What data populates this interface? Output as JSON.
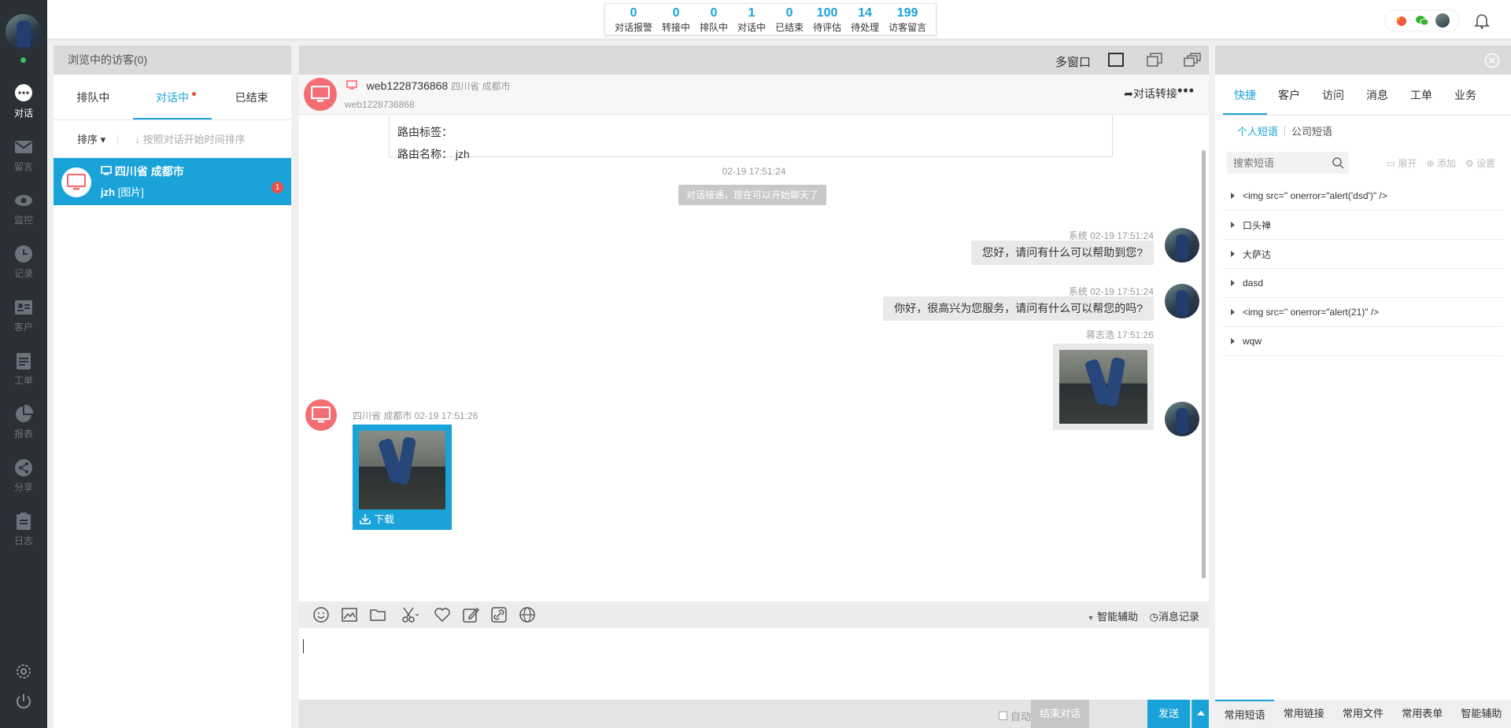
{
  "nav": {
    "items": [
      {
        "label": "对话",
        "icon": "chat-icon"
      },
      {
        "label": "留言",
        "icon": "mail-icon"
      },
      {
        "label": "监控",
        "icon": "eye-icon"
      },
      {
        "label": "记录",
        "icon": "clock-icon"
      },
      {
        "label": "客户",
        "icon": "id-card-icon"
      },
      {
        "label": "工单",
        "icon": "ticket-icon"
      },
      {
        "label": "报表",
        "icon": "pie-chart-icon"
      },
      {
        "label": "分享",
        "icon": "share-icon"
      },
      {
        "label": "日志",
        "icon": "clipboard-icon"
      }
    ]
  },
  "stats": [
    {
      "num": "0",
      "label": "对话报警"
    },
    {
      "num": "0",
      "label": "转接中"
    },
    {
      "num": "0",
      "label": "排队中"
    },
    {
      "num": "1",
      "label": "对话中"
    },
    {
      "num": "0",
      "label": "已结束"
    },
    {
      "num": "100",
      "label": "待评估"
    },
    {
      "num": "14",
      "label": "待处理"
    },
    {
      "num": "199",
      "label": "访客留言"
    }
  ],
  "visitors": {
    "title": "浏览中的访客(0)",
    "tabs": [
      "排队中",
      "对话中",
      "已结束"
    ],
    "sort_label": "排序",
    "sort_hint": "按照对话开始时间排序",
    "conversation": {
      "location": "四川省 成都市",
      "name": "jzh",
      "last_msg": "[图片]",
      "unread": "1"
    }
  },
  "chat": {
    "multi_window": "多窗口",
    "visitor_name": "web1228736868",
    "visitor_location": "四川省 成都市",
    "visitor_sub": "web1228736868",
    "transfer": "对话转接",
    "route_tag": "路由标签：",
    "route_name": "路由名称：  jzh",
    "time1": "02-19 17:51:24",
    "sys_note": "对话接通，现在可以开始聊天了",
    "msg1_meta": "系统  02-19 17:51:24",
    "msg1": "您好，请问有什么可以帮助到您?",
    "msg2_meta": "系统  02-19 17:51:24",
    "msg2": "你好，很高兴为您服务，请问有什么可以帮您的吗?",
    "msg3_meta": "蒋志浩  17:51:26",
    "msg4_meta": "四川省 成都市  02-19 17:51:26",
    "download": "下载",
    "assist": "智能辅助",
    "history": "消息记录",
    "auto_switch": "自动切换对话",
    "end_btn": "结束对话",
    "send_btn": "发送"
  },
  "right": {
    "tabs": [
      "快捷",
      "客户",
      "访问",
      "消息",
      "工单",
      "业务"
    ],
    "subtabs": [
      "个人短语",
      "公司短语"
    ],
    "search_placeholder": "搜索短语",
    "tool_expand": "展开",
    "tool_add": "添加",
    "tool_settings": "设置",
    "phrases": [
      "<img src='' onerror=\"alert('dsd')\" />",
      "口头禅",
      "大萨达",
      "dasd",
      "<img src='' onerror=\"alert(21)\" />",
      "wqw"
    ],
    "footer": [
      "常用短语",
      "常用链接",
      "常用文件",
      "常用表单",
      "智能辅助"
    ]
  },
  "colors": {
    "accent": "#1aa3d9",
    "nav_bg": "#2b2f36",
    "visitor_avatar": "#f36e72",
    "badge": "#e8514a"
  }
}
